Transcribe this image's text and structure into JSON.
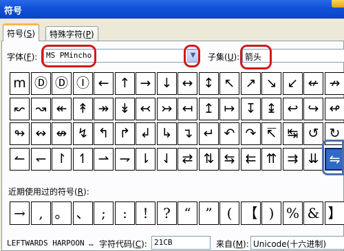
{
  "window": {
    "title": "符号"
  },
  "tabs": [
    {
      "label": "符号(",
      "key": "S",
      "suffix": ")"
    },
    {
      "label": "特殊字符(",
      "key": "P",
      "suffix": ")"
    }
  ],
  "font": {
    "label_pre": "字体(",
    "key": "F",
    "label_post": "):",
    "value": "MS PMincho"
  },
  "subset": {
    "label_pre": "子集(",
    "key": "U",
    "label_post": "):",
    "value": "箭头"
  },
  "symbols": [
    [
      "m",
      "Ⓓ",
      "Ⓓ",
      "Ⓘ",
      "←",
      "↑",
      "→",
      "↓",
      "↔",
      "↕",
      "↖",
      "↗",
      "↘",
      "↙",
      "↚",
      "↛"
    ],
    [
      "↜",
      "↝",
      "↞",
      "↟",
      "↠",
      "↡",
      "↢",
      "↣",
      "↤",
      "↥",
      "↦",
      "↧",
      "↨",
      "↩",
      "↪",
      "↫"
    ],
    [
      "↬",
      "↭",
      "↮",
      "↯",
      "↰",
      "↱",
      "↲",
      "↳",
      "↴",
      "↵",
      "↶",
      "↷",
      "↸",
      "↹",
      "↺",
      "↻"
    ],
    [
      "↼",
      "↽",
      "↾",
      "↿",
      "⇀",
      "⇁",
      "⇂",
      "⇃",
      "⇄",
      "⇅",
      "⇆",
      "⇇",
      "⇈",
      "⇉",
      "⇊",
      "⇋"
    ]
  ],
  "recent_label_pre": "近期使用过的符号(",
  "recent_key": "R",
  "recent_label_post": "):",
  "recent": [
    "→",
    ",",
    "。",
    "、",
    ";",
    ":",
    "!",
    "?",
    "“",
    "”",
    "(",
    "【",
    ")",
    "%",
    "&",
    "】"
  ],
  "status": {
    "char_name": "LEFTWARDS HARPOON …",
    "code_label_pre": "字符代码(",
    "code_key": "C",
    "code_label_post": "):",
    "code_value": "21CB",
    "from_label_pre": "来自(",
    "from_key": "M",
    "from_label_post": "):",
    "from_value": "Unicode(十六进制)"
  },
  "colors": {
    "title_bar": "#0a44c4",
    "highlight": "#d01818",
    "selection": "#3169c6"
  }
}
